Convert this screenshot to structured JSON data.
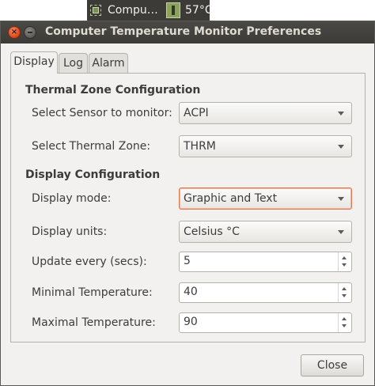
{
  "panel": {
    "app_label": "Compu…",
    "temperature": "57°C"
  },
  "window": {
    "title": "Computer Temperature Monitor Preferences"
  },
  "tabs": [
    {
      "label": "Display",
      "active": true
    },
    {
      "label": "Log",
      "active": false
    },
    {
      "label": "Alarm",
      "active": false
    }
  ],
  "thermal": {
    "heading": "Thermal Zone Configuration",
    "sensor_label": "Select Sensor to monitor:",
    "sensor_value": "ACPI",
    "zone_label": "Select Thermal Zone:",
    "zone_value": "THRM"
  },
  "display": {
    "heading": "Display Configuration",
    "mode_label": "Display mode:",
    "mode_value": "Graphic and Text",
    "units_label": "Display units:",
    "units_value": "Celsius °C",
    "update_label": "Update every (secs):",
    "update_value": "5",
    "min_label": "Minimal Temperature:",
    "min_value": "40",
    "max_label": "Maximal Temperature:",
    "max_value": "90"
  },
  "buttons": {
    "close": "Close"
  },
  "icons": {
    "close_window": "close-icon",
    "minimize_window": "minimize-icon",
    "applet": "chip-icon",
    "thermometer": "thermometer-icon"
  },
  "colors": {
    "titlebar": "#3c3b37",
    "close_button": "#e05a2b",
    "focus_border": "#e07a52",
    "background": "#f2f1f0"
  }
}
